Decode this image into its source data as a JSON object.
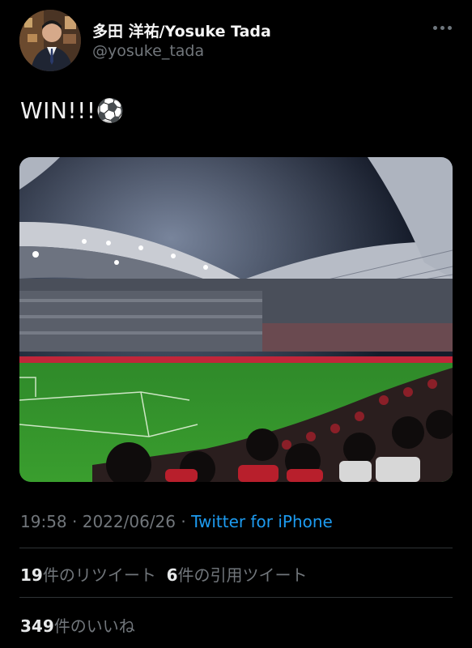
{
  "tweet": {
    "author_name": "多田 洋祐/Yosuke Tada",
    "author_handle": "@yosuke_tada",
    "text": "WIN!!!⚽",
    "time": "19:58",
    "date": "2022/06/26",
    "separator": " · ",
    "source": "Twitter for iPhone"
  },
  "stats": {
    "retweets_count": "19",
    "retweets_label": "件のリツイート",
    "quotes_count": "6",
    "quotes_label": "件の引用ツイート",
    "likes_count": "349",
    "likes_label": "件のいいね"
  },
  "colors": {
    "background": "#000000",
    "text_primary": "#e7e9ea",
    "text_secondary": "#71767b",
    "link": "#1d9bf0",
    "divider": "#2f3336"
  },
  "icons": {
    "more": "more-dots-icon",
    "avatar": "avatar"
  }
}
